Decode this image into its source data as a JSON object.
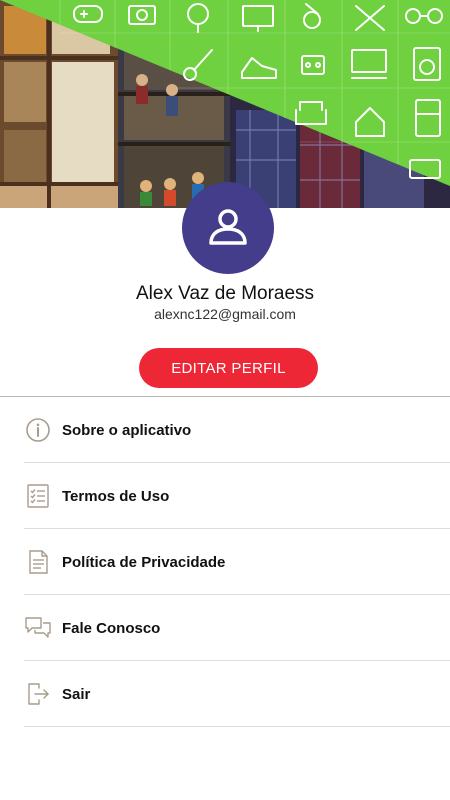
{
  "profile": {
    "name": "Alex Vaz de Moraess",
    "email": "alexnc122@gmail.com",
    "edit_label": "EDITAR PERFIL"
  },
  "menu": {
    "items": [
      {
        "label": "Sobre o aplicativo",
        "icon": "info-icon"
      },
      {
        "label": "Termos de Uso",
        "icon": "checklist-icon"
      },
      {
        "label": "Política de Privacidade",
        "icon": "document-icon"
      },
      {
        "label": "Fale Conosco",
        "icon": "chat-icon"
      },
      {
        "label": "Sair",
        "icon": "exit-icon"
      }
    ]
  },
  "colors": {
    "banner_green": "#6fd13f",
    "avatar_bg": "#433d8b",
    "button_red": "#ee2737"
  }
}
